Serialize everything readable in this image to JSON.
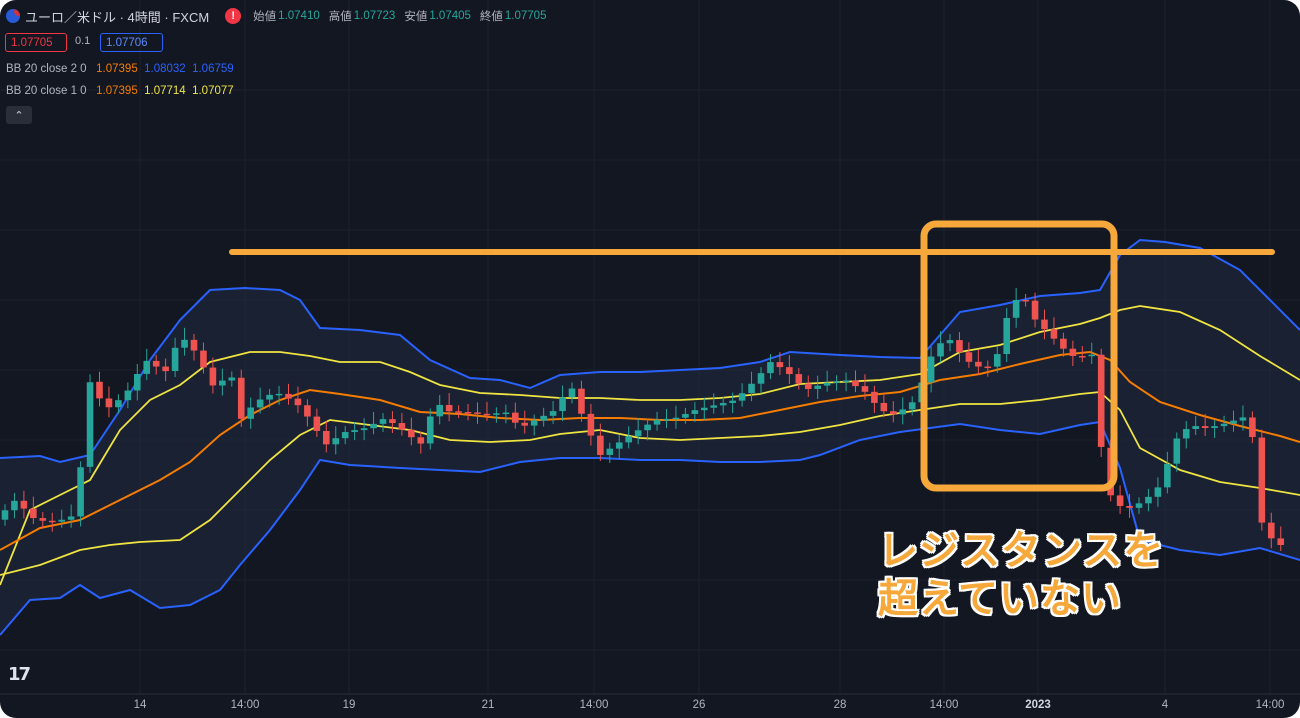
{
  "header": {
    "symbol": "ユーロ／米ドル · 4時間 · FXCM",
    "alert_glyph": "!",
    "open_label": "始値",
    "open": "1.07410",
    "high_label": "高値",
    "high": "1.07723",
    "low_label": "安値",
    "low": "1.07405",
    "close_label": "終値",
    "close": "1.07705"
  },
  "trade": {
    "sell": "1.07705",
    "spread": "0.1",
    "buy": "1.07706"
  },
  "indicators": [
    {
      "name": "BB 20 close 2 0",
      "basis": "1.07395",
      "upper": "1.08032",
      "lower": "1.06759"
    },
    {
      "name": "BB 20 close 1 0",
      "basis": "1.07395",
      "upper": "1.07714",
      "lower": "1.07077"
    }
  ],
  "collapse_glyph": "⌃",
  "annotation": {
    "line1": "レジスタンスを",
    "line2": "超えていない"
  },
  "logo": "17",
  "x_axis": [
    "14",
    "14:00",
    "19",
    "21",
    "14:00",
    "26",
    "28",
    "14:00",
    "2023",
    "4",
    "14:00"
  ],
  "colors": {
    "background": "#131722",
    "up": "#26a69a",
    "down": "#ef5350",
    "bb2": "#2962ff",
    "bb1": "#f0e442",
    "basis": "#f57c00",
    "annotation": "#f6a83b"
  }
}
